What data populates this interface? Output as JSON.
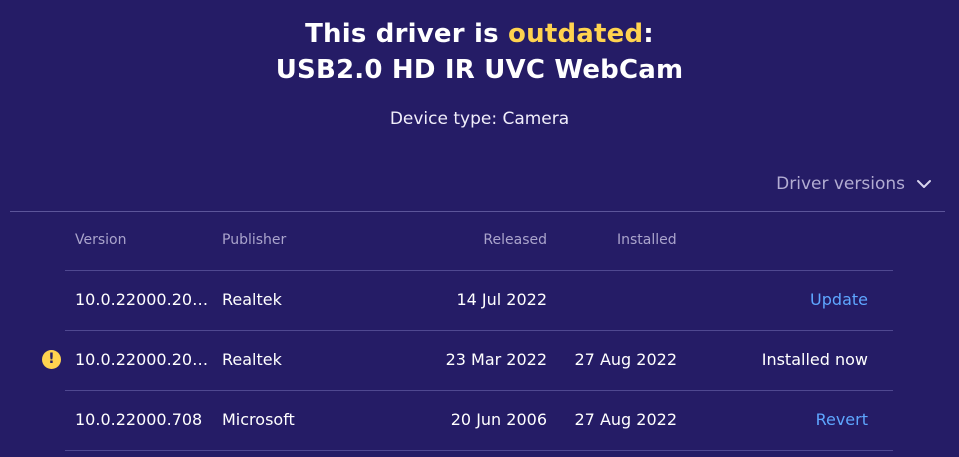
{
  "header": {
    "title_prefix": "This driver is ",
    "title_accent": "outdated",
    "title_suffix": ":",
    "device_name": "USB2.0 HD IR UVC WebCam",
    "device_type": "Device type: Camera"
  },
  "versions_toggle": {
    "label": "Driver versions",
    "icon": "chevron-down-icon"
  },
  "table": {
    "columns": {
      "version": "Version",
      "publisher": "Publisher",
      "released": "Released",
      "installed": "Installed"
    },
    "rows": [
      {
        "version": "10.0.22000.202…",
        "publisher": "Realtek",
        "released": "14 Jul 2022",
        "installed": "",
        "action": "Update",
        "warning": false
      },
      {
        "version": "10.0.22000.202…",
        "publisher": "Realtek",
        "released": "23 Mar 2022",
        "installed": "27 Aug 2022",
        "action": "Installed now",
        "warning": true,
        "warning_icon": "exclamation-icon",
        "warning_glyph": "!"
      },
      {
        "version": "10.0.22000.708",
        "publisher": "Microsoft",
        "released": "20 Jun 2006",
        "installed": "27 Aug 2022",
        "action": "Revert",
        "warning": false
      }
    ]
  },
  "colors": {
    "background": "#251c66",
    "accent": "#ffd34f",
    "link": "#5ea6ff",
    "muted": "#aaa4cc"
  }
}
